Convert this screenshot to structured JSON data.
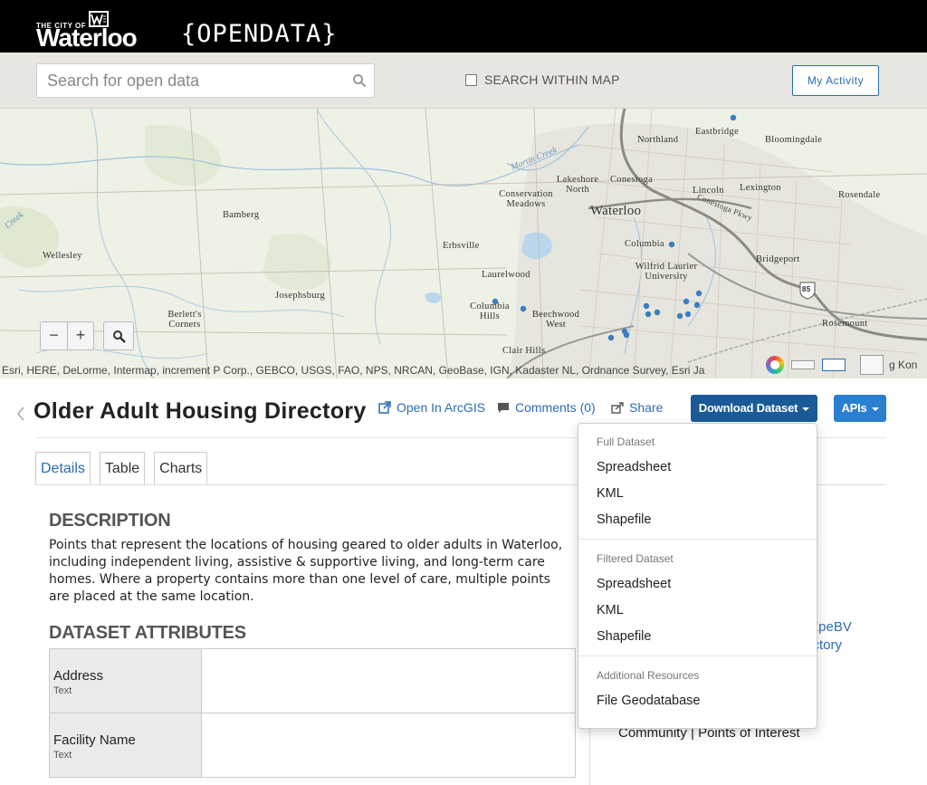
{
  "header": {
    "logo_small": "THE CITY OF",
    "logo_big": "Waterloo",
    "portal_title": "{OPENDATA}"
  },
  "search": {
    "placeholder": "Search for open data",
    "within_map_label": "SEARCH WITHIN MAP",
    "within_map_checked": false,
    "my_activity_label": "My Activity"
  },
  "map": {
    "zoom_out_label": "−",
    "zoom_in_label": "+",
    "attribution": "Esri, HERE, DeLorme, Intermap, increment P Corp., GEBCO, USGS, FAO, NPS, NRCAN, GeoBase, IGN, Kadaster NL, Ordnance Survey, Esri Ja",
    "places": [
      {
        "name": "Northland"
      },
      {
        "name": "Eastbridge"
      },
      {
        "name": "Bloomingdale"
      },
      {
        "name": "Lakeshore North"
      },
      {
        "name": "Conestoga"
      },
      {
        "name": "Conservation Meadows"
      },
      {
        "name": "Lincoln"
      },
      {
        "name": "Lexington"
      },
      {
        "name": "Rosendale"
      },
      {
        "name": "Bamberg"
      },
      {
        "name": "Waterloo"
      },
      {
        "name": "Erbsville"
      },
      {
        "name": "Columbia"
      },
      {
        "name": "Wellesley"
      },
      {
        "name": "Wilfrid Laurier University"
      },
      {
        "name": "Bridgeport"
      },
      {
        "name": "Laurelwood"
      },
      {
        "name": "Josephsburg"
      },
      {
        "name": "Columbia Hills"
      },
      {
        "name": "Beechwood West"
      },
      {
        "name": "Berlett's Corners"
      },
      {
        "name": "Rosemount"
      },
      {
        "name": "Clair Hills"
      }
    ],
    "water_labels": [
      "Martin Creek",
      "Creek"
    ],
    "highway_shield": "85",
    "road_label": "Conestoga Pkwy",
    "edge_label": "g Kon"
  },
  "dataset": {
    "title": "Older Adult Housing Directory",
    "open_in_arcgis": "Open In ArcGIS",
    "comments": "Comments (0)",
    "share": "Share",
    "download_label": "Download Dataset",
    "apis_label": "APIs",
    "accent_color": "#1a5a96",
    "apis_color": "#2a7fd0"
  },
  "tabs": [
    {
      "label": "Details",
      "active": true
    },
    {
      "label": "Table",
      "active": false
    },
    {
      "label": "Charts",
      "active": false
    }
  ],
  "details": {
    "description_heading": "DESCRIPTION",
    "description": "Points that represent the locations of housing geared to older adults in Waterloo, including independent living, assistive & supportive living, and long-term care homes. Where a property contains more than one level of care, multiple points are placed at the same location.",
    "attributes_heading": "DATASET ATTRIBUTES",
    "attributes": [
      {
        "name": "Address",
        "type": "Text"
      },
      {
        "name": "Facility Name",
        "type": "Text"
      }
    ]
  },
  "sidebar": {
    "link_fragment_1": "om/ZpeBV",
    "link_fragment_2": "Directory",
    "tags": "Community | Points of Interest"
  },
  "download_menu": {
    "groups": [
      {
        "heading": "Full Dataset",
        "items": [
          "Spreadsheet",
          "KML",
          "Shapefile"
        ]
      },
      {
        "heading": "Filtered Dataset",
        "items": [
          "Spreadsheet",
          "KML",
          "Shapefile"
        ]
      },
      {
        "heading": "Additional Resources",
        "items": [
          "File Geodatabase"
        ]
      }
    ]
  }
}
